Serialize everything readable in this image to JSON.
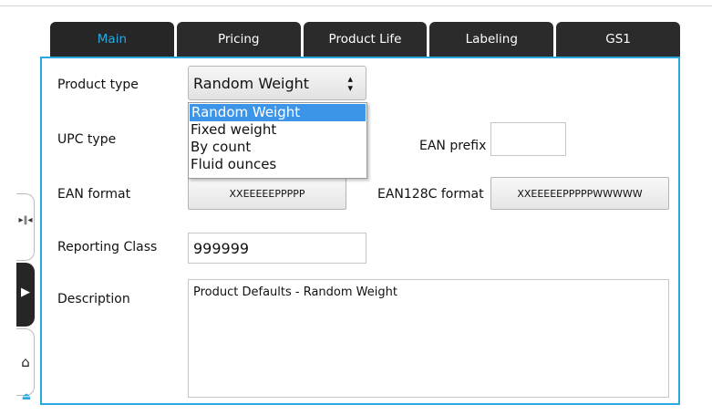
{
  "tabs": [
    {
      "label": "Main",
      "active": true
    },
    {
      "label": "Pricing"
    },
    {
      "label": "Product Life"
    },
    {
      "label": "Labeling"
    },
    {
      "label": "GS1"
    }
  ],
  "form": {
    "product_type_label": "Product type",
    "product_type_value": "Random Weight",
    "product_type_options": [
      "Random Weight",
      "Fixed weight",
      "By count",
      "Fluid ounces"
    ],
    "upc_type_label": "UPC type",
    "ean_prefix_label": "EAN prefix",
    "ean_prefix_value": "",
    "ean_format_label": "EAN format",
    "ean_format_value": "XXEEEEEPPPPP",
    "ean128c_label": "EAN128C format",
    "ean128c_value": "XXEEEEEPPPPPWWWWW",
    "reporting_class_label": "Reporting Class",
    "reporting_class_value": "999999",
    "description_label": "Description",
    "description_value": "Product Defaults - Random Weight"
  },
  "side": {
    "icons": [
      "collapse-arrows-icon",
      "play-arrow-icon",
      "home-icon",
      "eject-icon"
    ]
  },
  "colors": {
    "accent": "#29a9e0",
    "tab_bg": "#2b2b2b",
    "selection": "#3d95ea"
  }
}
